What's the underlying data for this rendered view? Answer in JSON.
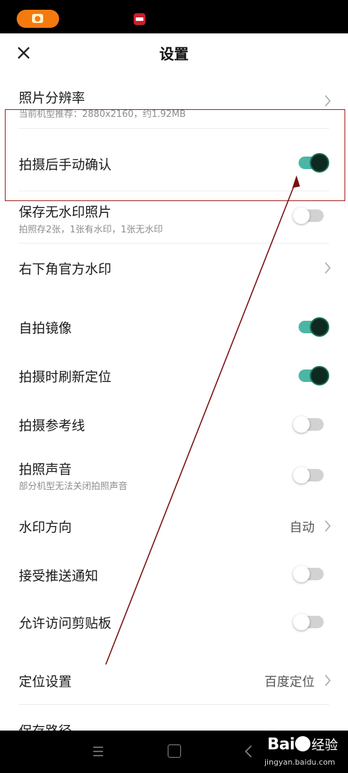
{
  "header": {
    "title": "设置"
  },
  "rows": {
    "resolution": {
      "label": "照片分辨率",
      "sub": "当前机型推荐：2880x2160，约1.92MB"
    },
    "manual_confirm": {
      "label": "拍摄后手动确认",
      "on": true
    },
    "no_watermark": {
      "label": "保存无水印照片",
      "sub": "拍照存2张，1张有水印，1张无水印",
      "on": false
    },
    "official_watermark": {
      "label": "右下角官方水印"
    },
    "selfie_mirror": {
      "label": "自拍镜像",
      "on": true
    },
    "refresh_location": {
      "label": "拍摄时刷新定位",
      "on": true
    },
    "grid_lines": {
      "label": "拍摄参考线",
      "on": false
    },
    "shutter_sound": {
      "label": "拍照声音",
      "sub": "部分机型无法关闭拍照声音",
      "on": false
    },
    "watermark_direction": {
      "label": "水印方向",
      "value": "自动"
    },
    "push_notify": {
      "label": "接受推送通知",
      "on": false
    },
    "clipboard": {
      "label": "允许访问剪贴板",
      "on": false
    },
    "location_settings": {
      "label": "定位设置",
      "value": "百度定位"
    },
    "save_path": {
      "label": "保存路径"
    }
  },
  "watermark": {
    "logo": "Bai",
    "logo_tail": "",
    "text": "经验",
    "url": "jingyan.baidu.com"
  },
  "colors": {
    "toggle_on": "#4bb6a6",
    "toggle_off": "#d2d2d2",
    "highlight": "#9e1b1b",
    "accent_orange": "#f47a10"
  },
  "icons": [
    "close-icon",
    "chevron-right-icon",
    "camera-icon",
    "menu-icon",
    "home-icon",
    "back-icon"
  ]
}
